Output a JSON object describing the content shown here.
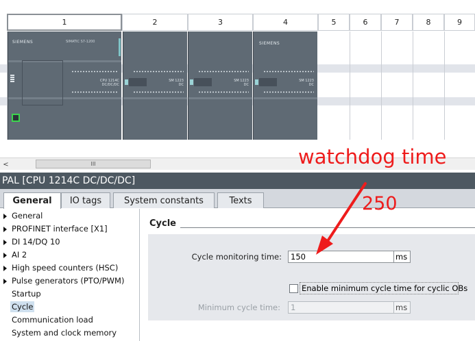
{
  "rack": {
    "slots": [
      "1",
      "2",
      "3",
      "4",
      "5",
      "6",
      "7",
      "8",
      "9"
    ],
    "modules": [
      {
        "brand": "SIEMENS",
        "type": "SIMATIC S7-1200",
        "label_line1": "CPU 1214C",
        "label_line2": "DC/DC/DC"
      },
      {
        "label_line1": "SM 1223",
        "label_line2": "DC"
      },
      {
        "label_line1": "SM 1223",
        "label_line2": "DC"
      },
      {
        "label_line1": "SM 1223",
        "label_line2": "DC"
      }
    ]
  },
  "scrollbar": {
    "left_arrow": "<",
    "thumb_grip": "III"
  },
  "properties": {
    "title": "PAL [CPU 1214C DC/DC/DC]",
    "tabs": [
      "General",
      "IO tags",
      "System constants",
      "Texts"
    ],
    "active_tab": "General"
  },
  "tree": {
    "items": [
      {
        "label": "General",
        "expandable": true
      },
      {
        "label": "PROFINET interface [X1]",
        "expandable": true
      },
      {
        "label": "DI 14/DQ 10",
        "expandable": true
      },
      {
        "label": "AI 2",
        "expandable": true
      },
      {
        "label": "High speed counters (HSC)",
        "expandable": true
      },
      {
        "label": "Pulse generators (PTO/PWM)",
        "expandable": true
      },
      {
        "label": "Startup",
        "expandable": false
      },
      {
        "label": "Cycle",
        "expandable": false,
        "selected": true
      },
      {
        "label": "Communication load",
        "expandable": false
      },
      {
        "label": "System and clock memory",
        "expandable": false
      }
    ]
  },
  "cycle": {
    "section_title": "Cycle",
    "monitoring_label": "Cycle monitoring time:",
    "monitoring_value": "150",
    "monitoring_unit": "ms",
    "enable_min_label": "Enable minimum cycle time for cyclic OBs",
    "enable_min_checked": false,
    "min_label": "Minimum cycle time:",
    "min_value": "1",
    "min_unit": "ms"
  },
  "annotation": {
    "text": "watchdog time",
    "value": "250",
    "color": "#ee1c1c"
  }
}
